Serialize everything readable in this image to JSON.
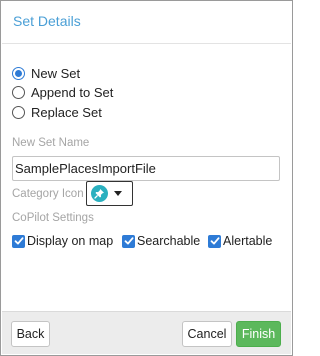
{
  "dialog": {
    "title": "Set Details"
  },
  "set_mode": {
    "options": [
      {
        "label": "New Set",
        "selected": true
      },
      {
        "label": "Append to Set",
        "selected": false
      },
      {
        "label": "Replace Set",
        "selected": false
      }
    ]
  },
  "set_name": {
    "label": "New Set Name",
    "value": "SamplePlacesImportFile"
  },
  "category_icon": {
    "label": "Category Icon",
    "icon": "pushpin-icon",
    "color": "#2ab0bf"
  },
  "copilot_settings": {
    "label": "CoPilot Settings",
    "options": [
      {
        "label": "Display on map",
        "checked": true
      },
      {
        "label": "Searchable",
        "checked": true
      },
      {
        "label": "Alertable",
        "checked": true
      }
    ]
  },
  "footer": {
    "back_label": "Back",
    "cancel_label": "Cancel",
    "finish_label": "Finish"
  },
  "colors": {
    "accent": "#2e7bd6",
    "title": "#4a9fd6",
    "finish": "#5cb85c"
  }
}
